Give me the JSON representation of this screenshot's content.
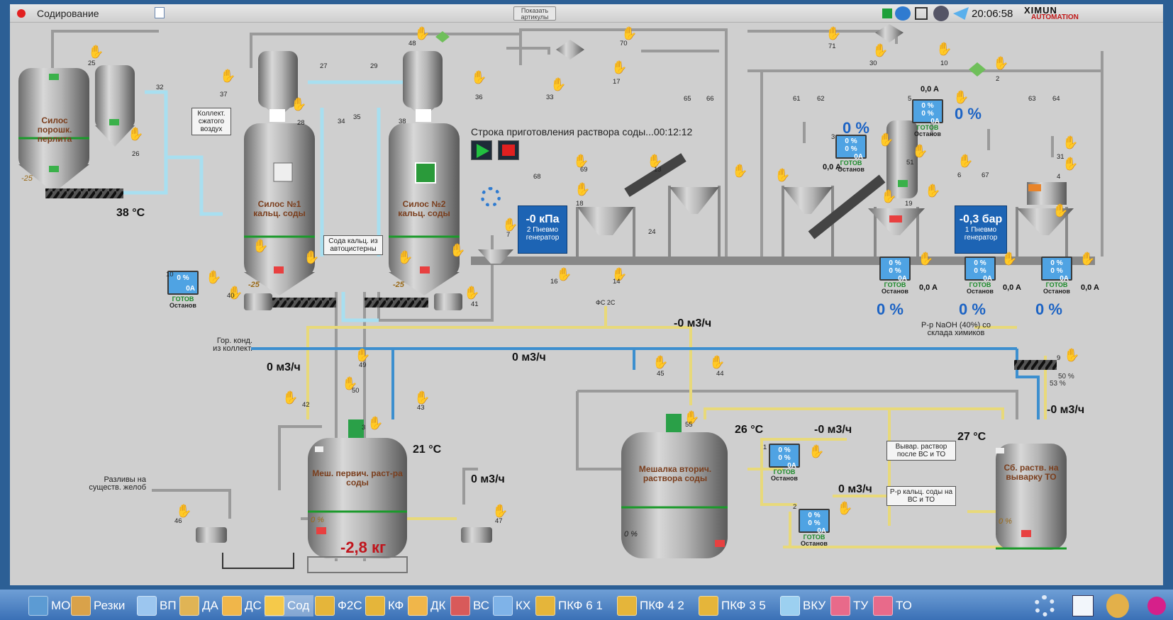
{
  "window": {
    "title": "Содирование",
    "show_articles_btn": "Показать артикулы",
    "clock": "20:06:58",
    "brand_top": "XIMUN",
    "brand_bottom": "AUTOMATION"
  },
  "silos": {
    "perlite": "Силос порошк. перлита",
    "perlite_val": "-25",
    "silo1": "Силос №1 кальц. соды",
    "silo1_val": "-25",
    "silo2": "Силос №2 кальц. соды",
    "silo2_val": "-25"
  },
  "tanks": {
    "primary": "Меш. первич. раст-ра соды",
    "primary_pct": "0 %",
    "primary_temp": "21 °C",
    "primary_weight": "-2,8 кг",
    "secondary": "Мешалка вторич. раствора соды",
    "secondary_pct": "0 %",
    "secondary_temp": "26 °C",
    "collector": "Сб. раств. на выварку ТО",
    "collector_pct": "0 %",
    "collector_temp": "27 °C"
  },
  "labels": {
    "compressed_air": "Коллект. сжатого воздух",
    "truck_soda": "Сода кальц. из автоцистерны",
    "hot_cond": "Гор. конд. из коллект.",
    "spill": "Разливы на существ. желоб",
    "naoh": "Р-р NaOH (40%) со склада химиков",
    "boil_after": "Вывар. раствор после ВС и ТО",
    "calc_soda": "Р-р кальц. соды на ВС и ТО",
    "fs2c": "ФС 2С",
    "temp_perlite": "38 °C",
    "line_status": "Строка приготовления раствора соды...00:12:12",
    "ready": "ГОТОВ",
    "stop": "Останов"
  },
  "generators": {
    "g2_value": "-0 кПа",
    "g2_name": "2 Пневмо генератор",
    "g1_value": "-0,3 бар",
    "g1_name": "1 Пневмо генератор"
  },
  "flows": {
    "f1": "0 м3/ч",
    "f2": "0 м3/ч",
    "f3": "-0 м3/ч",
    "f4": "-0 м3/ч",
    "f5": "0 м3/ч",
    "f6": "-0 м3/ч",
    "f7": "0 м3/ч"
  },
  "percent": {
    "p1": "0 %",
    "p2": "0 %",
    "p3": "0 %",
    "p4": "0 %",
    "p5": "0 %",
    "valve9a": "50 %",
    "valve9b": "53 %"
  },
  "currents": {
    "c1": "0,0 A",
    "c2": "0,0 A",
    "c3": "0,0 A",
    "c4": "0,0 A",
    "c5": "0,0 A"
  },
  "monitors": {
    "v1": "0 %",
    "v2": "0 %",
    "oa": "0A"
  },
  "ids": [
    "25",
    "32",
    "26",
    "37",
    "27",
    "28",
    "34",
    "29",
    "35",
    "38",
    "36",
    "48",
    "70",
    "33",
    "17",
    "71",
    "30",
    "10",
    "2",
    "65",
    "66",
    "61",
    "62",
    "63",
    "64",
    "5",
    "3",
    "51",
    "6",
    "67",
    "31",
    "4",
    "19",
    "68",
    "69",
    "13",
    "18",
    "24",
    "16",
    "14",
    "7",
    "40",
    "41",
    "10",
    "49",
    "50",
    "42",
    "43",
    "3",
    "45",
    "44",
    "55",
    "46",
    "47",
    "1",
    "2",
    "9"
  ],
  "taskbar": [
    "МО",
    "Резки",
    "ВП",
    "ДА",
    "ДС",
    "Сод",
    "Ф2С",
    "КФ",
    "ДК",
    "ВС",
    "КХ",
    "ПКФ 6 1",
    "ПКФ 4 2",
    "ПКФ 3 5",
    "ВКУ",
    "ТУ",
    "ТО"
  ],
  "taskbar_active": "Сод",
  "colors": {
    "scene": "#cfcfcf",
    "pipe": "#999999",
    "pipe_yellow": "#e8d97a",
    "pipe_cyan": "#a8dff0",
    "pipe_blue": "#3c8fcf",
    "generator": "#1d64b4",
    "value_blue": "#1c63c4",
    "weight_red": "#c0141c"
  }
}
